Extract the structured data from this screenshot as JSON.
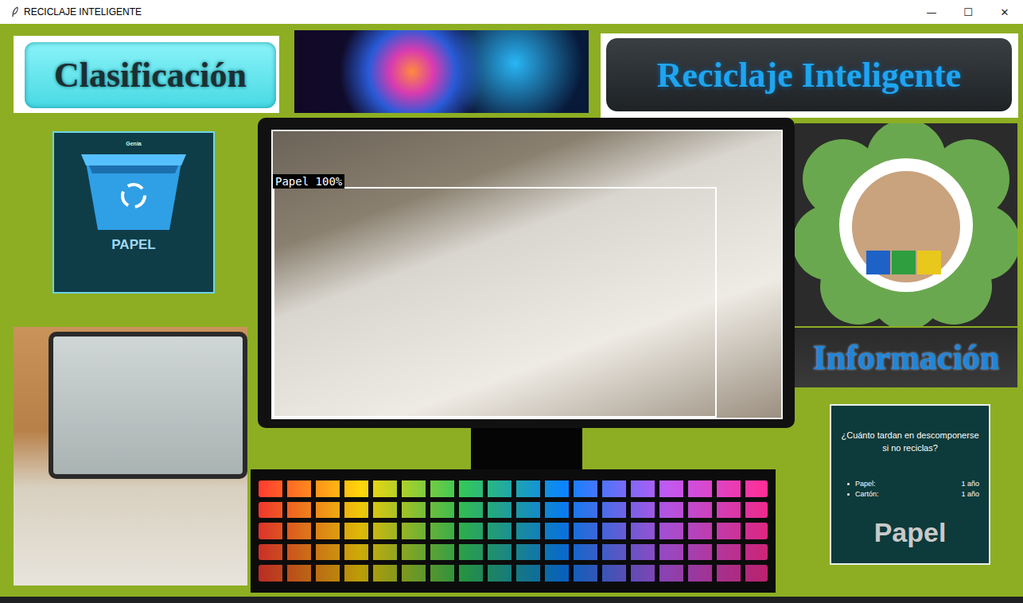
{
  "window": {
    "title": "RECICLAJE INTELIGENTE",
    "controls": [
      "—",
      "☐",
      "✕"
    ]
  },
  "banners": {
    "classification": "Clasificación",
    "app_title": "Reciclaje Inteligente",
    "information": "Información"
  },
  "bin_card": {
    "brand": "Genia",
    "label": "PAPEL"
  },
  "camera": {
    "detection": {
      "label": "Papel 100%"
    }
  },
  "info_card": {
    "question": "¿Cuánto tardan en descomponerse si no reciclas?",
    "items": [
      {
        "material": "Papel:",
        "time": "1 año"
      },
      {
        "material": "Cartón:",
        "time": "1 año"
      }
    ],
    "result": "Papel"
  }
}
